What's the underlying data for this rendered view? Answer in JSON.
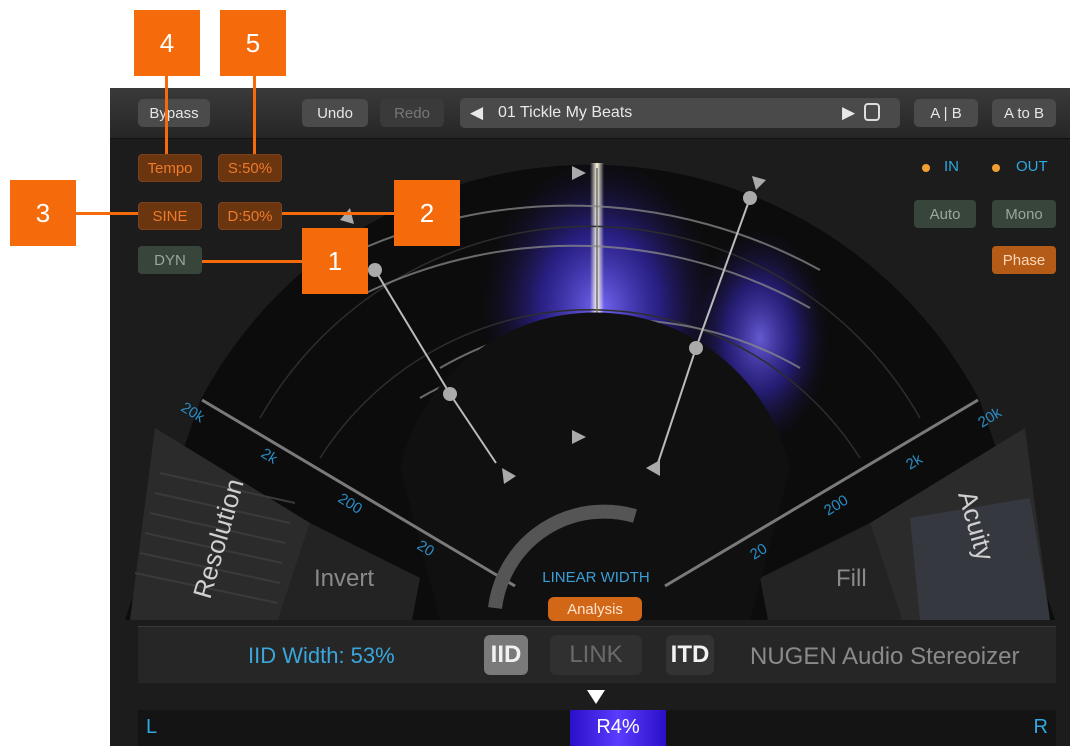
{
  "toolbar": {
    "bypass": "Bypass",
    "undo": "Undo",
    "redo": "Redo",
    "preset_name": "01 Tickle My Beats",
    "ab_label": "A | B",
    "a_to_b": "A to B"
  },
  "left_controls": {
    "tempo": "Tempo",
    "speed": "S:50%",
    "sine": "SINE",
    "depth": "D:50%",
    "dyn": "DYN"
  },
  "right_controls": {
    "in_label": "IN",
    "out_label": "OUT",
    "auto": "Auto",
    "mono": "Mono",
    "phase": "Phase"
  },
  "display": {
    "left_freq_labels": [
      "20k",
      "2k",
      "200",
      "20"
    ],
    "right_freq_labels": [
      "20k",
      "2k",
      "200",
      "20"
    ],
    "resolution": "Resolution",
    "invert": "Invert",
    "fill": "Fill",
    "acuity": "Acuity",
    "center_label": "LINEAR WIDTH",
    "analysis": "Analysis"
  },
  "bottom": {
    "width_readout": "IID Width: 53%",
    "iid": "IID",
    "link": "LINK",
    "itd": "ITD",
    "brand": "NUGEN Audio Stereoizer"
  },
  "balance": {
    "left": "L",
    "right": "R",
    "value": "R4%"
  },
  "callouts": [
    "1",
    "2",
    "3",
    "4",
    "5"
  ],
  "colors": {
    "accent_orange": "#f56a0b",
    "accent_blue": "#2fa9e0",
    "background": "#1c1c1c"
  }
}
